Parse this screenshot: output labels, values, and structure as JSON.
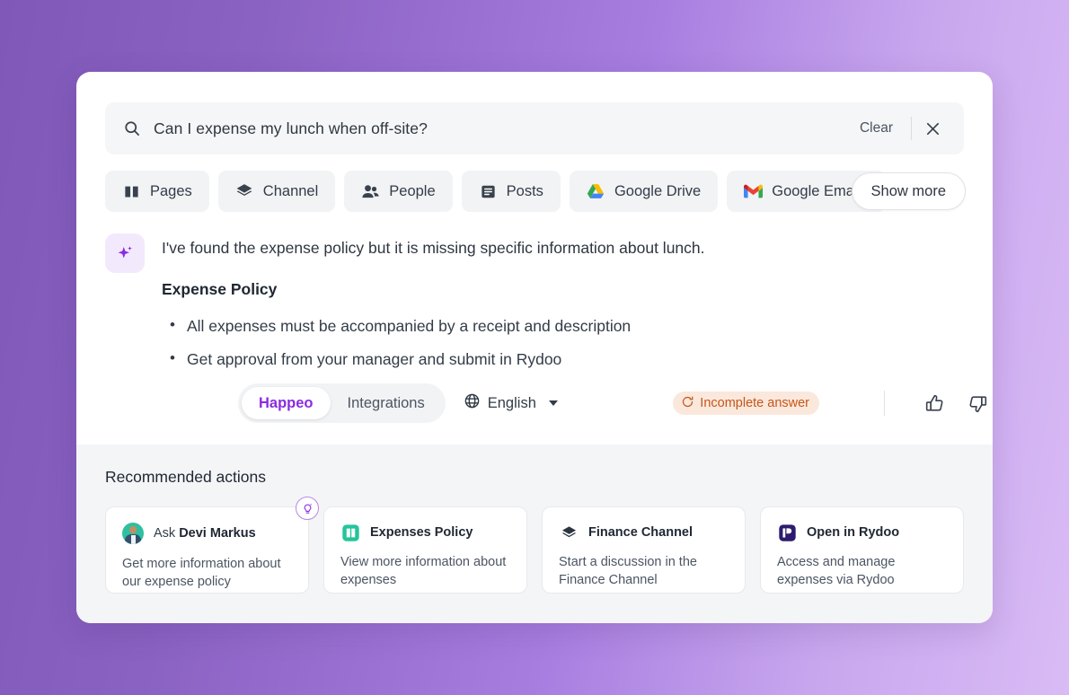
{
  "theme": {
    "bg_gradient_from": "#7f58b8",
    "bg_gradient_to": "#d9bbf5",
    "accent_purple": "#8a2be2",
    "card_bg": "#ffffff",
    "panel_bg": "#f4f5f7",
    "warning_bg": "#fbe8dc",
    "warning_fg": "#c4561a"
  },
  "search": {
    "query": "Can I expense my lunch when off-site?",
    "clear_label": "Clear",
    "search_icon": "search-icon",
    "close_icon": "close-icon"
  },
  "filters": {
    "chips": [
      {
        "label": "Pages",
        "icon": "book-icon"
      },
      {
        "label": "Channel",
        "icon": "layers-icon"
      },
      {
        "label": "People",
        "icon": "people-icon"
      },
      {
        "label": "Posts",
        "icon": "posts-icon"
      },
      {
        "label": "Google Drive",
        "icon": "google-drive-icon"
      },
      {
        "label": "Google Emails",
        "icon": "gmail-icon"
      }
    ],
    "show_more_label": "Show more"
  },
  "answer": {
    "ai_icon": "sparkle-icon",
    "lead": "I've found the expense policy but it is missing specific information about lunch.",
    "heading": "Expense Policy",
    "bullets": [
      "All expenses must be accompanied by a receipt and description",
      "Get approval from your manager and submit in Rydoo"
    ]
  },
  "toolbar": {
    "tabs": [
      {
        "label": "Happeo",
        "active": true
      },
      {
        "label": "Integrations",
        "active": false
      }
    ],
    "language": "English",
    "language_icon": "globe-icon",
    "status_badge": "Incomplete answer",
    "status_icon": "warning-rotate-icon",
    "thumbs_up_icon": "thumbs-up-icon",
    "thumbs_down_icon": "thumbs-down-icon"
  },
  "recommended": {
    "title": "Recommended actions",
    "cards": [
      {
        "icon": "avatar",
        "name_prefix": "Ask ",
        "name": "Devi Markus",
        "desc": "Get more information about our expense policy",
        "badge_icon": "lightbulb-idea-icon",
        "has_badge": true
      },
      {
        "icon": "book-teal-icon",
        "name_prefix": "",
        "name": "Expenses Policy",
        "desc": "View more information about expenses",
        "has_badge": false
      },
      {
        "icon": "layers-icon",
        "name_prefix": "",
        "name": "Finance Channel",
        "desc": "Start a discussion in the Finance Channel",
        "has_badge": false
      },
      {
        "icon": "rydoo-icon",
        "name_prefix": "",
        "name": "Open in Rydoo",
        "desc": "Access and manage expenses via Rydoo",
        "has_badge": false
      }
    ]
  }
}
